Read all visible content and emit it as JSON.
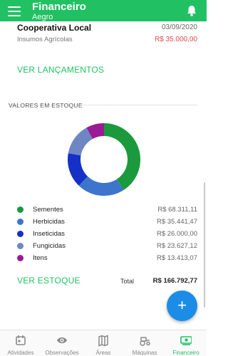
{
  "appbar": {
    "title": "Financeiro",
    "subtitle": "Aegro"
  },
  "previous_entry": {
    "name": "Cooperativa Local",
    "date": "03/09/2020",
    "category": "Insumos Agrícolas",
    "value": "R$ 35.000,00"
  },
  "launches_link": "VER LANÇAMENTOS",
  "stock": {
    "label": "VALORES EM ESTOQUE",
    "items": [
      {
        "name": "Sementes",
        "value": "R$ 68.311,11",
        "color": "#1a9a3c"
      },
      {
        "name": "Herbicidas",
        "value": "R$ 35.441,47",
        "color": "#3d74cc"
      },
      {
        "name": "Inseticidas",
        "value": "R$ 26.000,00",
        "color": "#1530c6"
      },
      {
        "name": "Fungicidas",
        "value": "R$ 23.627,12",
        "color": "#6f86c4"
      },
      {
        "name": "Itens",
        "value": "R$ 13.413,07",
        "color": "#9a1a96"
      }
    ],
    "link": "VER ESTOQUE",
    "total_label": "Total",
    "total_value": "R$ 166.792,77"
  },
  "chart_data": {
    "type": "pie",
    "categories": [
      "Sementes",
      "Herbicidas",
      "Inseticidas",
      "Fungicidas",
      "Itens"
    ],
    "values": [
      68311.11,
      35441.47,
      26000.0,
      23627.12,
      13413.07
    ],
    "colors": [
      "#1a9a3c",
      "#3d74cc",
      "#1530c6",
      "#6f86c4",
      "#9a1a96"
    ],
    "donut": true
  },
  "fab": "+",
  "nav": [
    {
      "label": "Atividades",
      "icon": "calendar-icon",
      "active": false
    },
    {
      "label": "Observações",
      "icon": "eye-icon",
      "active": false
    },
    {
      "label": "Áreas",
      "icon": "map-icon",
      "active": false
    },
    {
      "label": "Máquinas",
      "icon": "tractor-icon",
      "active": false
    },
    {
      "label": "Financeiro",
      "icon": "money-icon",
      "active": true
    }
  ],
  "colors": {
    "primary": "#21c163",
    "expense": "#e04b4b",
    "fab": "#1c8de6"
  }
}
